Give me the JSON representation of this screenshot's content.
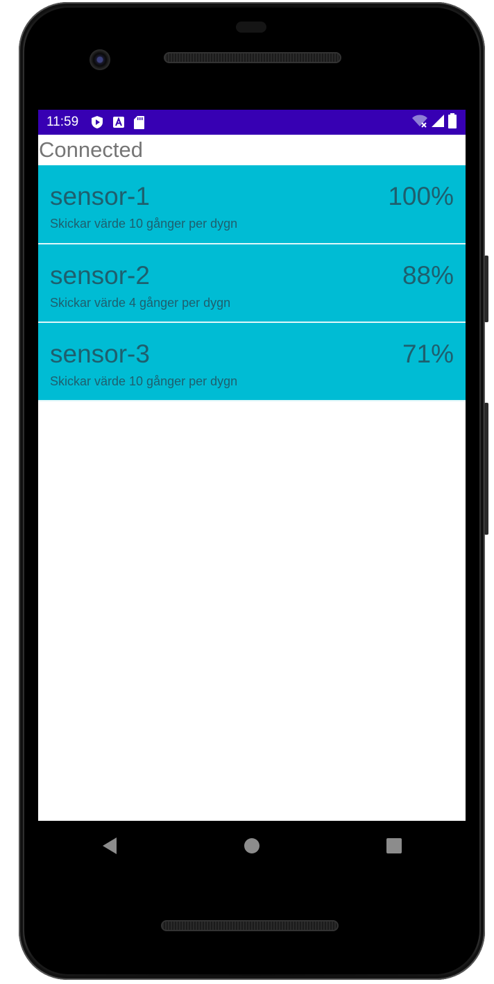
{
  "status_bar": {
    "time": "11:59",
    "left_icons": [
      "shield-play-icon",
      "a-letter-icon",
      "sd-card-icon"
    ],
    "right_icons": [
      "wifi-off-icon",
      "signal-icon",
      "battery-icon"
    ],
    "background": "#3700b3"
  },
  "header": {
    "title": "Connected"
  },
  "sensors": [
    {
      "name": "sensor-1",
      "percent": "100%",
      "description": "Skickar värde 10 gånger per dygn"
    },
    {
      "name": "sensor-2",
      "percent": "88%",
      "description": "Skickar värde 4 gånger per dygn"
    },
    {
      "name": "sensor-3",
      "percent": "71%",
      "description": "Skickar värde 10 gånger per dygn"
    }
  ],
  "navigation": [
    "back-icon",
    "home-icon",
    "recents-icon"
  ],
  "colors": {
    "row_background": "#00bcd4",
    "row_text": "#1e5f6e",
    "title_text": "#757575"
  }
}
